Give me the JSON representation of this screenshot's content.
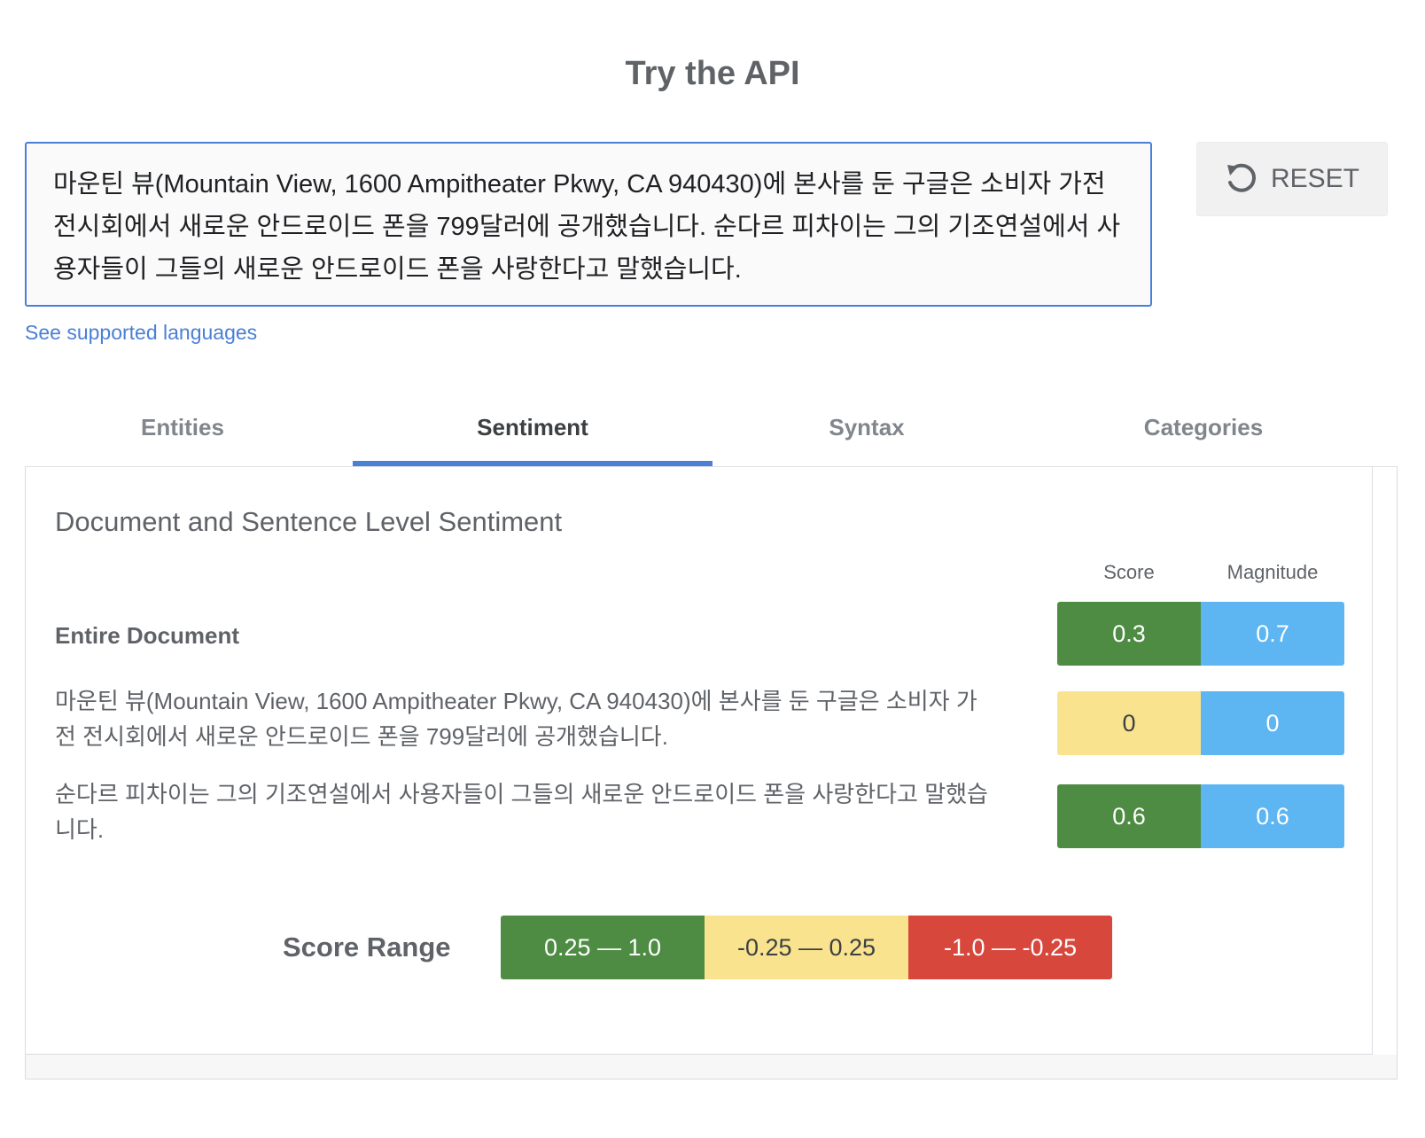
{
  "page": {
    "title": "Try the API"
  },
  "input": {
    "value": "마운틴 뷰(Mountain View, 1600 Ampitheater Pkwy, CA 940430)에 본사를 둔 구글은 소비자 가전 전시회에서 새로운 안드로이드 폰을 799달러에 공개했습니다. 순다르 피차이는 그의 기조연설에서 사용자들이 그들의 새로운 안드로이드 폰을 사랑한다고 말했습니다."
  },
  "reset_button": {
    "label": "RESET",
    "icon": "reset-icon"
  },
  "languages_link": "See supported languages",
  "tabs": [
    {
      "label": "Entities",
      "active": false
    },
    {
      "label": "Sentiment",
      "active": true
    },
    {
      "label": "Syntax",
      "active": false
    },
    {
      "label": "Categories",
      "active": false
    }
  ],
  "sentiment": {
    "section_title": "Document and Sentence Level Sentiment",
    "col_score": "Score",
    "col_magnitude": "Magnitude",
    "rows": [
      {
        "label": "Entire Document",
        "score": "0.3",
        "magnitude": "0.7",
        "score_color": "#4e8c43"
      },
      {
        "label": "마운틴 뷰(Mountain View, 1600 Ampitheater Pkwy, CA 940430)에 본사를 둔 구글은 소비자 가전 전시회에서 새로운 안드로이드 폰을 799달러에 공개했습니다.",
        "score": "0",
        "magnitude": "0",
        "score_color": "#f9e38e"
      },
      {
        "label": "순다르 피차이는 그의 기조연설에서 사용자들이 그들의 새로운 안드로이드 폰을 사랑한다고 말했습니다.",
        "score": "0.6",
        "magnitude": "0.6",
        "score_color": "#4e8c43"
      }
    ],
    "magnitude_color": "#5db5f2",
    "score_range": {
      "label": "Score Range",
      "ranges": [
        {
          "text": "0.25 — 1.0",
          "color": "#4e8c43"
        },
        {
          "text": "-0.25 — 0.25",
          "color": "#f9e38e"
        },
        {
          "text": "-1.0 — -0.25",
          "color": "#d8473c"
        }
      ]
    }
  }
}
